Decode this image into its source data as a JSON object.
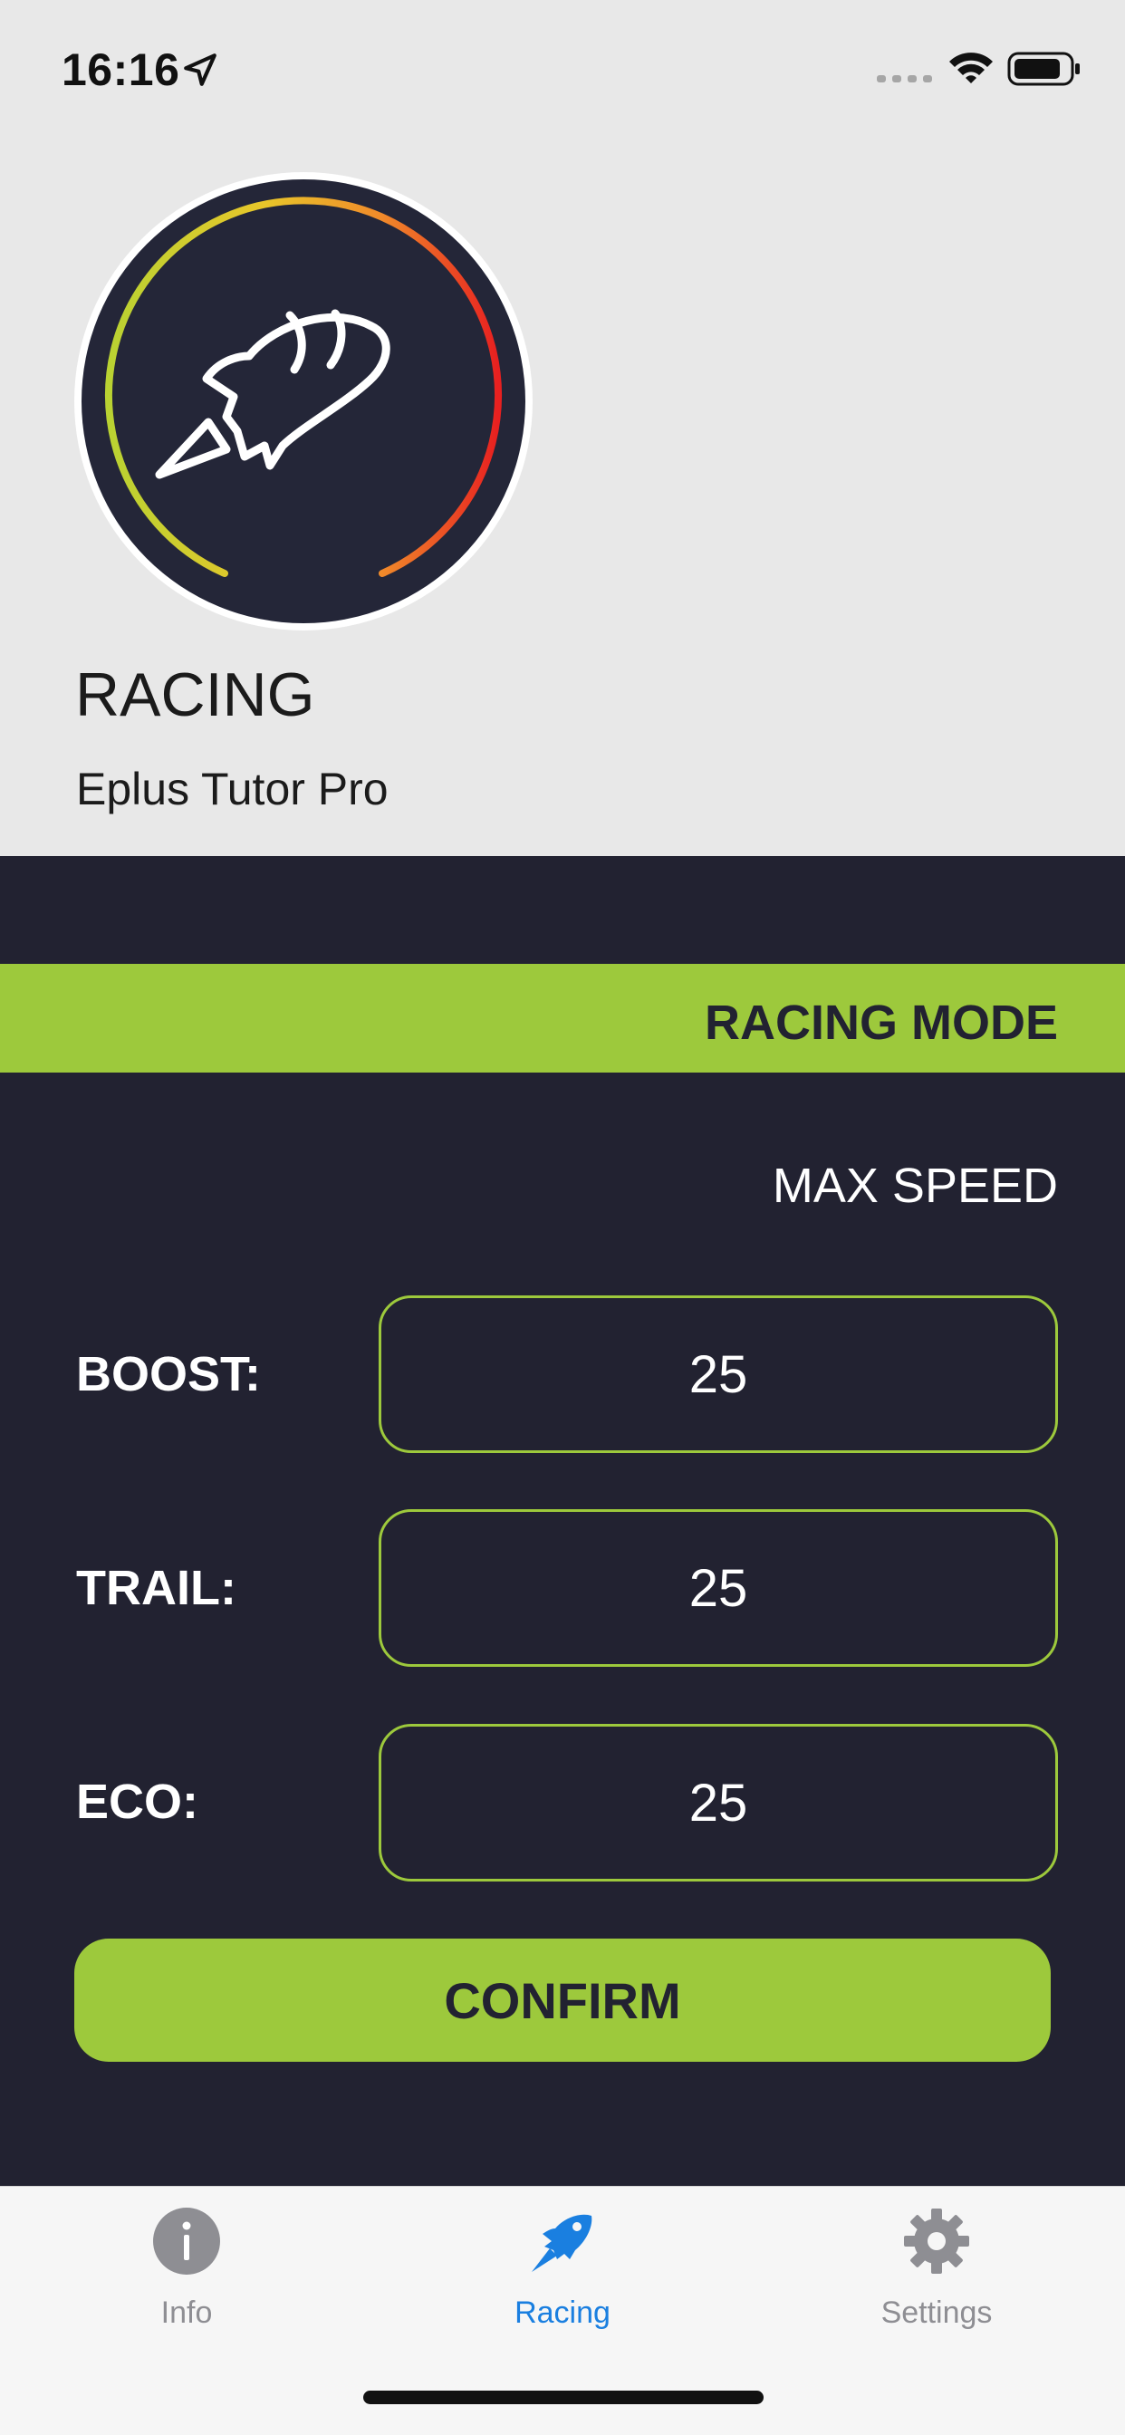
{
  "status_bar": {
    "time": "16:16"
  },
  "header": {
    "mode_title": "RACING",
    "device_name": "Eplus Tutor Pro",
    "logo_icon": "rocket-speedometer-icon"
  },
  "mode_banner": {
    "label": "RACING MODE"
  },
  "max_speed": {
    "section_label": "MAX SPEED",
    "fields": [
      {
        "label": "BOOST:",
        "value": "25"
      },
      {
        "label": "TRAIL:",
        "value": "25"
      },
      {
        "label": "ECO:",
        "value": "25"
      }
    ]
  },
  "confirm_button": {
    "label": "CONFIRM"
  },
  "tab_bar": {
    "tabs": [
      {
        "label": "Info",
        "icon": "info-icon",
        "active": false
      },
      {
        "label": "Racing",
        "icon": "rocket-icon",
        "active": true
      },
      {
        "label": "Settings",
        "icon": "gear-icon",
        "active": false
      }
    ]
  },
  "colors": {
    "accent": "#9dc93c",
    "panel_background": "#222231",
    "header_background": "#e8e8e8",
    "tab_active": "#1a7fe0",
    "tab_inactive": "#8e8e93"
  }
}
